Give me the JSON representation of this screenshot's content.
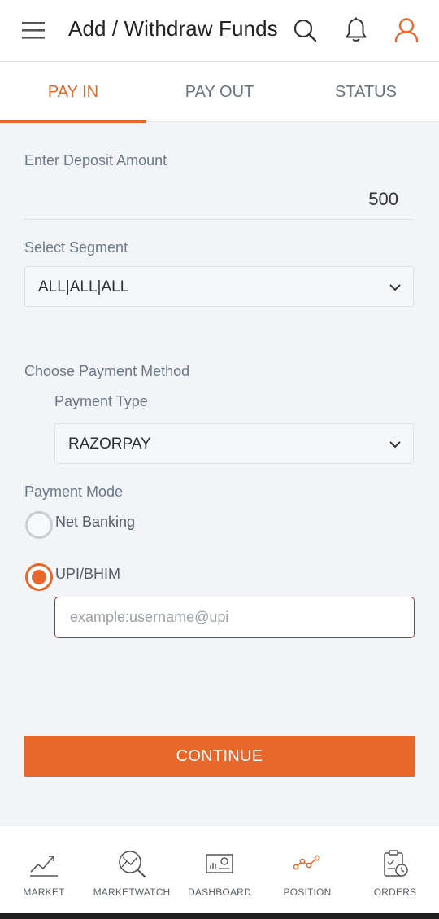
{
  "header": {
    "title": "Add / Withdraw Funds",
    "icons": {
      "menu": "hamburger-menu-icon",
      "search": "search-icon",
      "notifications": "bell-icon",
      "profile": "user-icon"
    },
    "accent_color": "#e8672b"
  },
  "tabs": [
    {
      "label": "PAY IN",
      "active": true
    },
    {
      "label": "PAY OUT",
      "active": false
    },
    {
      "label": "STATUS",
      "active": false
    }
  ],
  "form": {
    "deposit_label": "Enter Deposit Amount",
    "deposit_value": "500",
    "segment_label": "Select Segment",
    "segment_value": "ALL|ALL|ALL",
    "payment_method_label": "Choose Payment Method",
    "payment_type_label": "Payment Type",
    "payment_type_value": "RAZORPAY",
    "payment_mode_label": "Payment Mode",
    "modes": [
      {
        "label": "Net Banking",
        "selected": false
      },
      {
        "label": "UPI/BHIM",
        "selected": true
      }
    ],
    "upi_placeholder": "example:username@upi",
    "upi_value": "",
    "continue_label": "CONTINUE"
  },
  "bottom_nav": [
    {
      "label": "MARKET",
      "icon": "chart-line-icon"
    },
    {
      "label": "MARKETWATCH",
      "icon": "market-watch-icon"
    },
    {
      "label": "DASHBOARD",
      "icon": "dashboard-icon"
    },
    {
      "label": "POSITION",
      "icon": "position-icon",
      "accent": true
    },
    {
      "label": "ORDERS",
      "icon": "orders-icon"
    }
  ]
}
